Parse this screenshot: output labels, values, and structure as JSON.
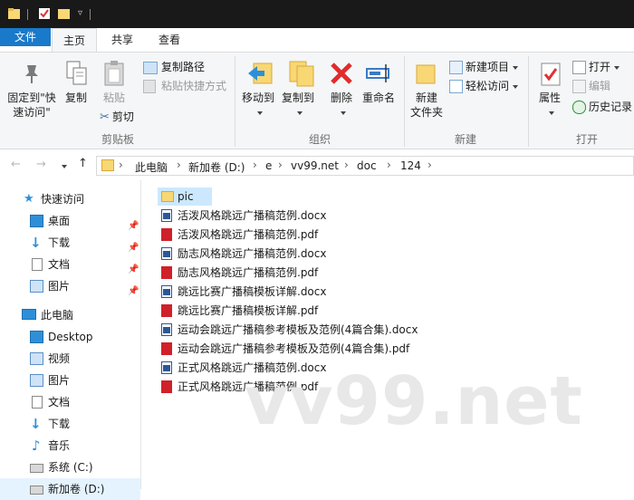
{
  "ribbon_tabs": {
    "file": "文件",
    "home": "主页",
    "share": "共享",
    "view": "查看"
  },
  "clipboard": {
    "pin_quick_access": [
      "固定到\"快",
      "速访问\""
    ],
    "copy": "复制",
    "paste": "粘贴",
    "copy_path": "复制路径",
    "paste_shortcut": "粘贴快捷方式",
    "cut": "剪切",
    "group": "剪贴板"
  },
  "organize": {
    "move_to": "移动到",
    "copy_to": "复制到",
    "delete": "删除",
    "rename": "重命名",
    "group": "组织"
  },
  "new": {
    "new_folder": [
      "新建",
      "文件夹"
    ],
    "new_item": "新建项目",
    "easy_access": "轻松访问",
    "group": "新建"
  },
  "open": {
    "properties": "属性",
    "open": "打开",
    "edit": "编辑",
    "history": "历史记录",
    "group": "打开"
  },
  "breadcrumb": [
    "此电脑",
    "新加卷 (D:)",
    "e",
    "vv99.net",
    "doc",
    "124"
  ],
  "nav": {
    "quick_access": "快速访问",
    "quick_items": [
      "桌面",
      "下载",
      "文档",
      "图片"
    ],
    "this_pc": "此电脑",
    "pc_items": [
      "Desktop",
      "视频",
      "图片",
      "文档",
      "下载",
      "音乐",
      "系统 (C:)",
      "新加卷 (D:)"
    ]
  },
  "files": [
    {
      "name": "pic",
      "type": "folder"
    },
    {
      "name": "活泼风格跳远广播稿范例.docx",
      "type": "docx"
    },
    {
      "name": "活泼风格跳远广播稿范例.pdf",
      "type": "pdf"
    },
    {
      "name": "励志风格跳远广播稿范例.docx",
      "type": "docx"
    },
    {
      "name": "励志风格跳远广播稿范例.pdf",
      "type": "pdf"
    },
    {
      "name": "跳远比赛广播稿模板详解.docx",
      "type": "docx"
    },
    {
      "name": "跳远比赛广播稿模板详解.pdf",
      "type": "pdf"
    },
    {
      "name": "运动会跳远广播稿参考模板及范例(4篇合集).docx",
      "type": "docx"
    },
    {
      "name": "运动会跳远广播稿参考模板及范例(4篇合集).pdf",
      "type": "pdf"
    },
    {
      "name": "正式风格跳远广播稿范例.docx",
      "type": "docx"
    },
    {
      "name": "正式风格跳远广播稿范例.pdf",
      "type": "pdf"
    }
  ],
  "watermark": "vv99.net",
  "colors": {
    "file_tab": "#1979ca",
    "selection": "#cce8ff",
    "folder": "#f8d775",
    "pdf": "#d0202a",
    "docx": "#2b579a"
  }
}
